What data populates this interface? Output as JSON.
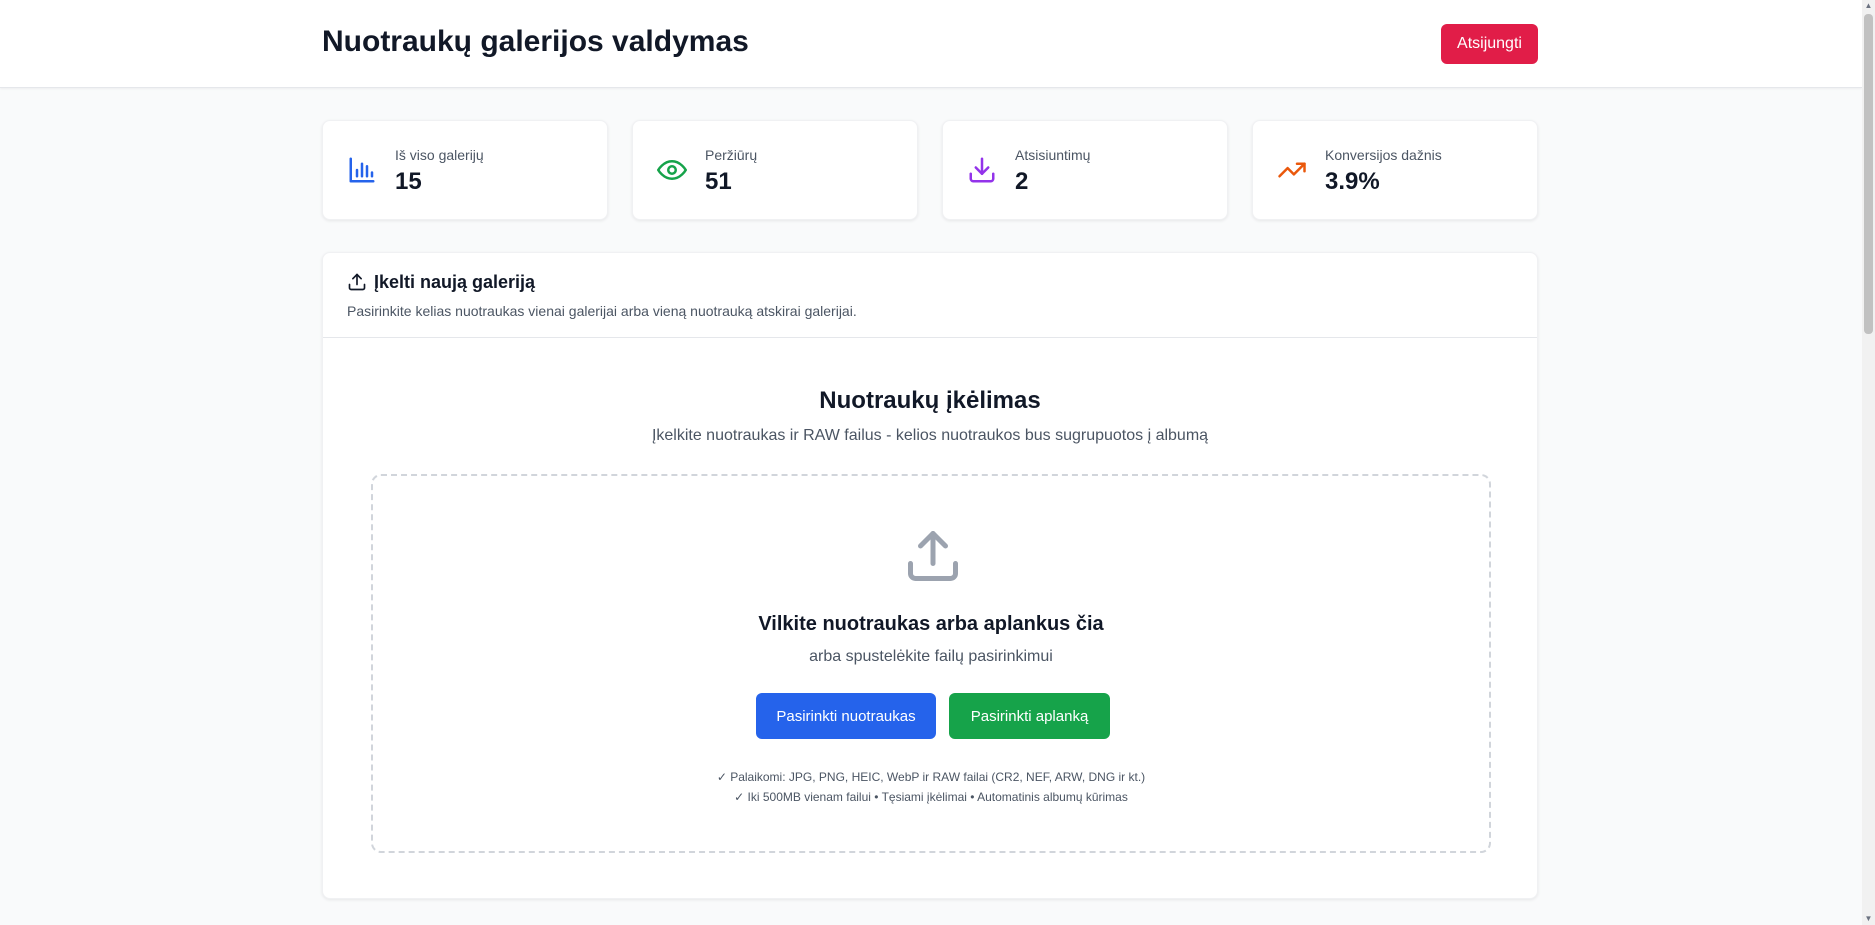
{
  "header": {
    "title": "Nuotraukų galerijos valdymas",
    "logout_label": "Atsijungti"
  },
  "stats": [
    {
      "label": "Iš viso galerijų",
      "value": "15",
      "icon": "bar-chart-icon",
      "color": "#2563eb"
    },
    {
      "label": "Peržiūrų",
      "value": "51",
      "icon": "eye-icon",
      "color": "#16a34a"
    },
    {
      "label": "Atsisiuntimų",
      "value": "2",
      "icon": "download-icon",
      "color": "#9333ea"
    },
    {
      "label": "Konversijos dažnis",
      "value": "3.9%",
      "icon": "trending-up-icon",
      "color": "#ea580c"
    }
  ],
  "upload_section": {
    "title": "Įkelti naują galeriją",
    "description": "Pasirinkite kelias nuotraukas vienai galerijai arba vieną nuotrauką atskirai galerijai.",
    "heading": "Nuotraukų įkėlimas",
    "subheading": "Įkelkite nuotraukas ir RAW failus - kelios nuotraukos bus sugrupuotos į albumą",
    "dropzone": {
      "title": "Vilkite nuotraukas arba aplankus čia",
      "subtitle": "arba spustelėkite failų pasirinkimui",
      "select_photos_label": "Pasirinkti nuotraukas",
      "select_folder_label": "Pasirinkti aplanką",
      "note_1": "✓ Palaikomi: JPG, PNG, HEIC, WebP ir RAW failai (CR2, NEF, ARW, DNG ir kt.)",
      "note_2": "✓ Iki 500MB vienam failui • Tęsiami įkėlimai • Automatinis albumų kūrimas"
    }
  },
  "colors": {
    "logout": "#e11d48",
    "primary": "#2563eb",
    "success": "#16a34a"
  }
}
